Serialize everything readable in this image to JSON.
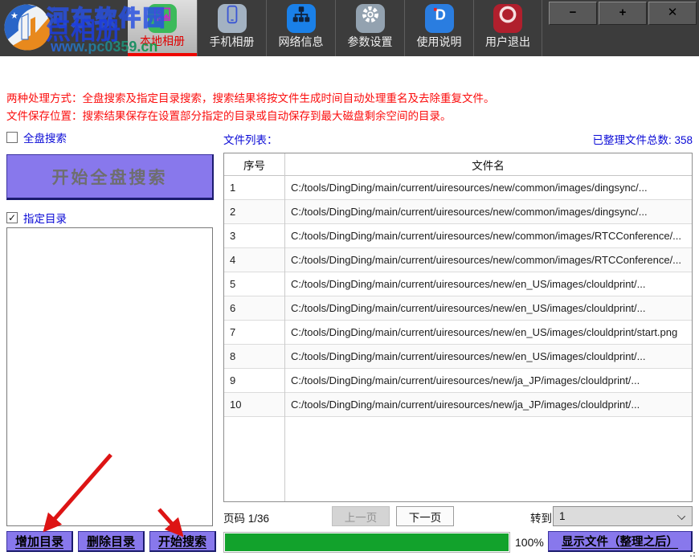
{
  "watermark": {
    "site_name": "河东软件园",
    "app_name": "点相册",
    "site_url": "www.pc0359.cn"
  },
  "toolbar": {
    "tabs": [
      {
        "label": "本地相册",
        "icon": "gallery-icon",
        "active": true
      },
      {
        "label": "手机相册",
        "icon": "phone-icon",
        "active": false
      },
      {
        "label": "网络信息",
        "icon": "network-icon",
        "active": false
      },
      {
        "label": "参数设置",
        "icon": "gear-icon",
        "active": false
      },
      {
        "label": "使用说明",
        "icon": "help-d-icon",
        "active": false
      },
      {
        "label": "用户退出",
        "icon": "logout-ring-icon",
        "active": false
      }
    ],
    "window_controls": {
      "minimize": "−",
      "maximize": "+",
      "close": "✕"
    }
  },
  "instructions": {
    "line1": "两种处理方式：全盘搜索及指定目录搜索，搜索结果将按文件生成时间自动处理重名及去除重复文件。",
    "line2": "文件保存位置：搜索结果保存在设置部分指定的目录或自动保存到最大磁盘剩余空间的目录。"
  },
  "left_panel": {
    "full_search_label": "全盘搜索",
    "full_search_checked": false,
    "start_full_search_button": "开始全盘搜索",
    "specify_dir_label": "指定目录",
    "specify_dir_checked": true,
    "add_dir_button": "增加目录",
    "delete_dir_button": "删除目录",
    "start_search_button": "开始搜索"
  },
  "file_panel": {
    "list_label": "文件列表：",
    "total_label": "已整理文件总数: 358",
    "table": {
      "headers": [
        "序号",
        "文件名"
      ],
      "rows": [
        {
          "index": "1",
          "path": "C:/tools/DingDing/main/current/uiresources/new/common/images/dingsync/..."
        },
        {
          "index": "2",
          "path": "C:/tools/DingDing/main/current/uiresources/new/common/images/dingsync/..."
        },
        {
          "index": "3",
          "path": "C:/tools/DingDing/main/current/uiresources/new/common/images/RTCConference/..."
        },
        {
          "index": "4",
          "path": "C:/tools/DingDing/main/current/uiresources/new/common/images/RTCConference/..."
        },
        {
          "index": "5",
          "path": "C:/tools/DingDing/main/current/uiresources/new/en_US/images/clouldprint/..."
        },
        {
          "index": "6",
          "path": "C:/tools/DingDing/main/current/uiresources/new/en_US/images/clouldprint/..."
        },
        {
          "index": "7",
          "path": "C:/tools/DingDing/main/current/uiresources/new/en_US/images/clouldprint/start.png"
        },
        {
          "index": "8",
          "path": "C:/tools/DingDing/main/current/uiresources/new/en_US/images/clouldprint/..."
        },
        {
          "index": "9",
          "path": "C:/tools/DingDing/main/current/uiresources/new/ja_JP/images/clouldprint/..."
        },
        {
          "index": "10",
          "path": "C:/tools/DingDing/main/current/uiresources/new/ja_JP/images/clouldprint/..."
        }
      ]
    },
    "pagination": {
      "page_label": "页码 1/36",
      "prev_button": "上一页",
      "next_button": "下一页",
      "goto_label": "转到",
      "goto_value": "1"
    },
    "progress": {
      "value": 100,
      "percent_label": "100%"
    },
    "show_files_button": "显示文件（整理之后）"
  },
  "colors": {
    "accent_purple": "#8878ec",
    "progress_green": "#12a22c",
    "label_blue": "#0a0ad6",
    "alert_red": "#fb0d0d",
    "active_tab_red": "#e80000",
    "toolbar_dark": "#3c3c3c"
  }
}
